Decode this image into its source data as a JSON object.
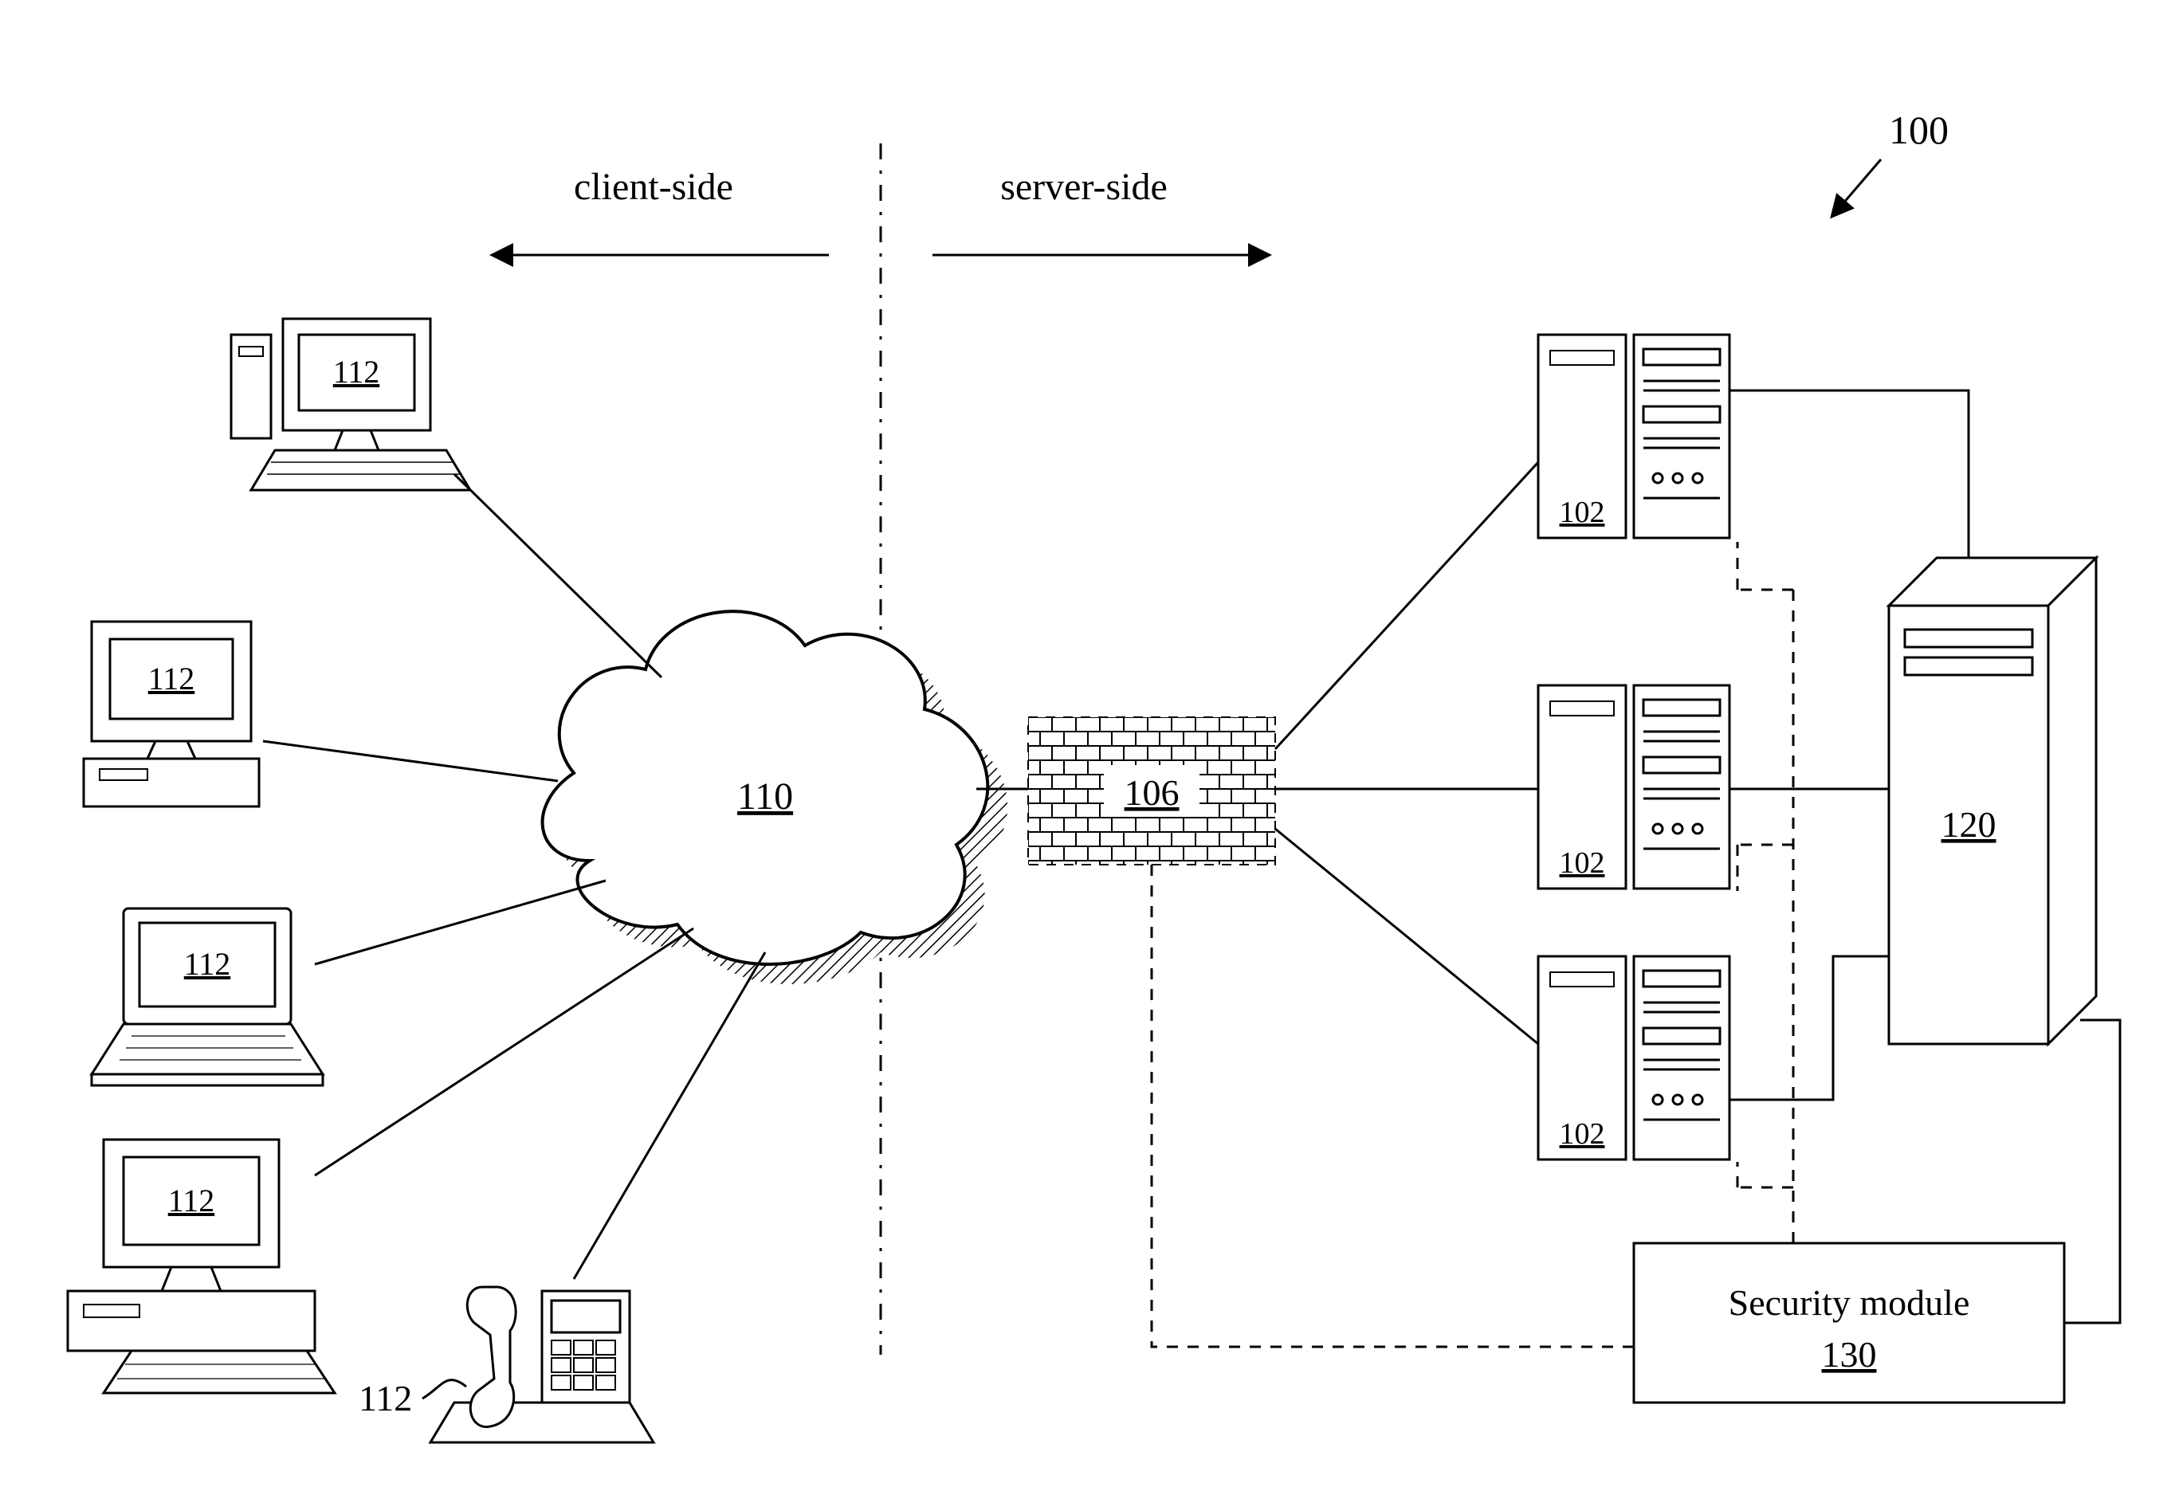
{
  "diagram": {
    "ref_100": "100",
    "client_side_label": "client-side",
    "server_side_label": "server-side",
    "cloud_label": "110",
    "firewall_label": "106",
    "big_server_label": "120",
    "security_module_title": "Security module",
    "security_module_label": "130",
    "client_112": "112",
    "phone_112": "112",
    "server_102": "102"
  }
}
